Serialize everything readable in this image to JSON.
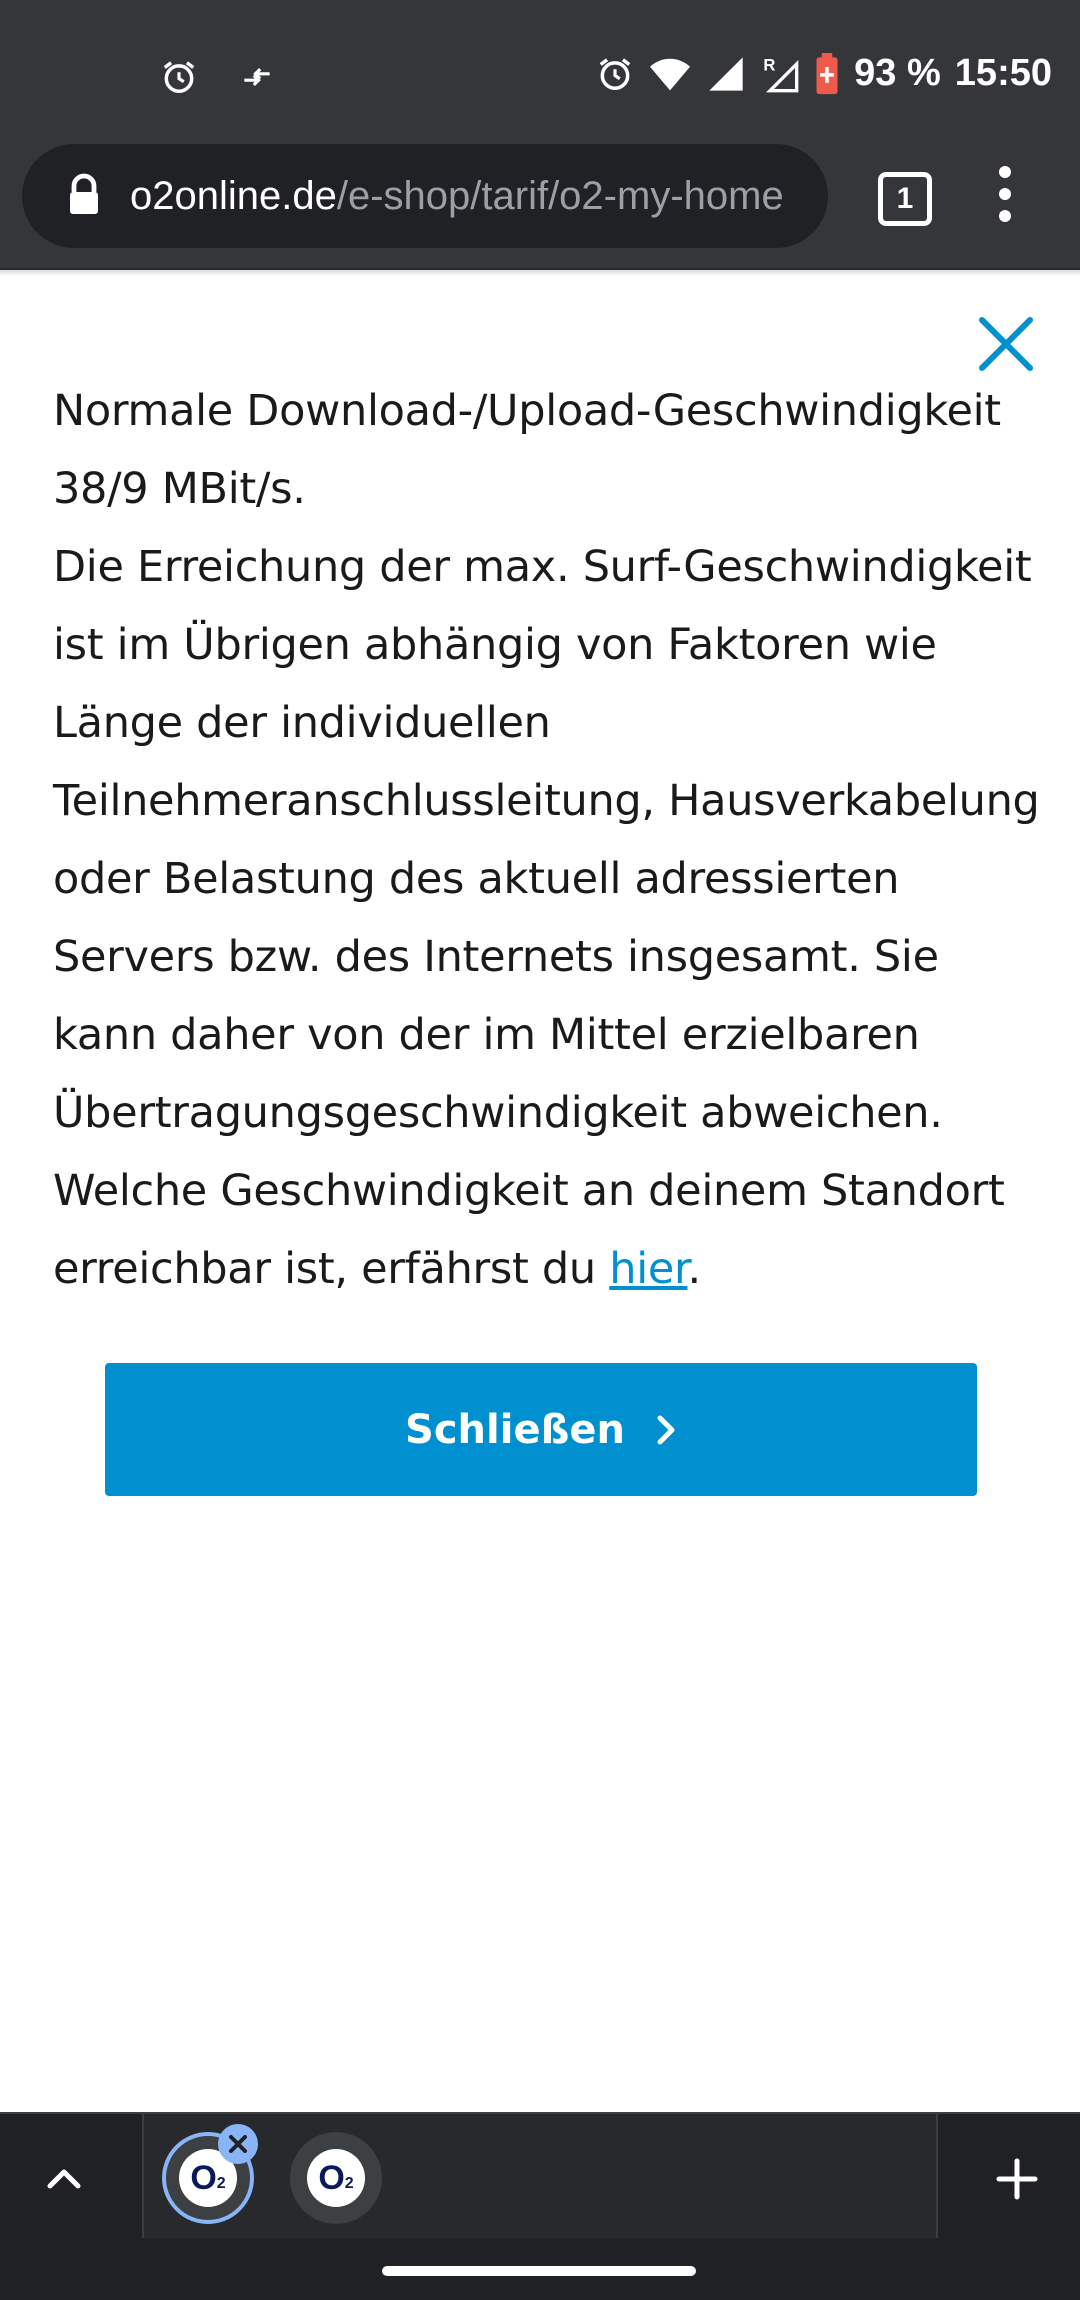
{
  "status_bar": {
    "battery": "93 %",
    "time": "15:50",
    "icons": [
      "alarm-icon",
      "data-transfer-icon",
      "alarm-icon",
      "wifi-icon",
      "signal-icon",
      "signal-r-icon",
      "battery-saver-icon"
    ]
  },
  "browser": {
    "url_domain": "o2online.de",
    "url_path": "/e-shop/tarif/o2-my-home",
    "tab_count": "1"
  },
  "modal": {
    "paragraph_1": "Normale Download-/Upload-Geschwindigkeit 38/9 MBit/s.",
    "paragraph_2": "Die Erreichung der max. Surf-Geschwindigkeit ist im Übrigen abhängig von Faktoren wie Länge der individuellen Teilnehmeranschlussleitung, Hausverkabelung oder Belastung des aktuell adressierten Servers bzw. des Internets insgesamt. Sie kann daher von der im Mittel erzielbaren Übertragungsgeschwindigkeit abweichen.",
    "paragraph_3_prefix": "Welche Geschwindigkeit an deinem Standort erreichbar ist, erfährst du ",
    "paragraph_3_link": "hier",
    "paragraph_3_suffix": ".",
    "button_label": "Schließen",
    "accent_color": "#0090d0"
  },
  "tab_strip": {
    "tabs": [
      {
        "label": "O",
        "sub": "2"
      },
      {
        "label": "O",
        "sub": "2"
      }
    ]
  }
}
